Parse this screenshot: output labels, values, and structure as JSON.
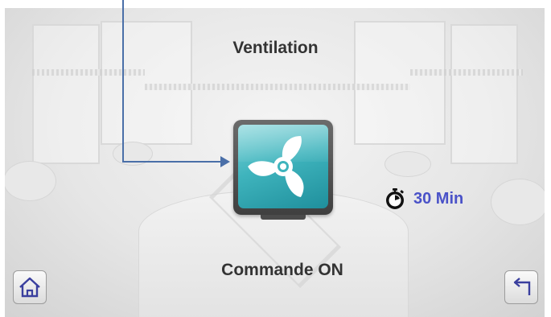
{
  "screen": {
    "title": "Ventilation",
    "status_text": "Commande ON"
  },
  "fan_button": {
    "icon": "fan-icon",
    "state": "ON",
    "accent_color": "#3fb4bd"
  },
  "timer": {
    "icon": "stopwatch-icon",
    "value": "30 Min",
    "color": "#4a52c8"
  },
  "navigation": {
    "home_icon": "home-icon",
    "back_icon": "back-arrow-icon"
  },
  "colors": {
    "text": "#333333",
    "pointer": "#4a6fa8"
  }
}
